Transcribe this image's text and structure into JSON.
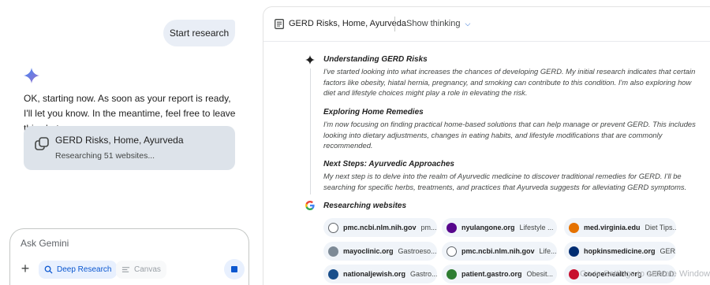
{
  "chat": {
    "user_message": "Start research",
    "reply_text": "OK, starting now. As soon as your report is ready, I'll let you know. In the meantime, feel free to leave this chat.",
    "report_card": {
      "title": "GERD Risks, Home, Ayurveda",
      "status": "Researching 51 websites..."
    },
    "input": {
      "placeholder": "Ask Gemini",
      "deep_research_label": "Deep Research",
      "canvas_label": "Canvas"
    }
  },
  "research_panel": {
    "title": "GERD Risks, Home, Ayurveda",
    "show_thinking_label": "Show thinking",
    "steps": [
      {
        "title": "Understanding GERD Risks",
        "body": "I've started looking into what increases the chances of developing GERD. My initial research indicates that certain factors like obesity, hiatal hernia, pregnancy, and smoking can contribute to this condition. I'm also exploring how diet and lifestyle choices might play a role in elevating the risk."
      },
      {
        "title": "Exploring Home Remedies",
        "body": "I'm now focusing on finding practical home-based solutions that can help manage or prevent GERD. This includes looking into dietary adjustments, changes in eating habits, and lifestyle modifications that are commonly recommended."
      },
      {
        "title": "Next Steps: Ayurvedic Approaches",
        "body": "My next step is to delve into the realm of Ayurvedic medicine to discover traditional remedies for GERD. I'll be searching for specific herbs, treatments, and practices that Ayurveda suggests for alleviating GERD symptoms."
      }
    ],
    "researching_title": "Researching websites",
    "sources": [
      {
        "domain": "pmc.ncbi.nlm.nih.gov",
        "desc": "pm...",
        "icon": "globe-icon",
        "color": "#5f6368"
      },
      {
        "domain": "nyulangone.org",
        "desc": "Lifestyle ...",
        "icon": "nyu-logo",
        "color": "#57068c"
      },
      {
        "domain": "med.virginia.edu",
        "desc": "Diet Tips...",
        "icon": "uva-logo",
        "color": "#e57200"
      },
      {
        "domain": "mayoclinic.org",
        "desc": "Gastroeso...",
        "icon": "mayo-logo",
        "color": "#7d8a96"
      },
      {
        "domain": "pmc.ncbi.nlm.nih.gov",
        "desc": "Life...",
        "icon": "globe-icon",
        "color": "#5f6368"
      },
      {
        "domain": "hopkinsmedicine.org",
        "desc": "GER...",
        "icon": "hopkins-logo",
        "color": "#002d72"
      },
      {
        "domain": "nationaljewish.org",
        "desc": "Gastro...",
        "icon": "nj-logo",
        "color": "#1a4f8b"
      },
      {
        "domain": "patient.gastro.org",
        "desc": "Obesit...",
        "icon": "agaf-logo",
        "color": "#2e7d32"
      },
      {
        "domain": "cooperhealth.org",
        "desc": "GERD D...",
        "icon": "cooper-logo",
        "color": "#c8102e"
      }
    ]
  },
  "overlay": {
    "watermark": "Go to Settings to activate Windows."
  }
}
